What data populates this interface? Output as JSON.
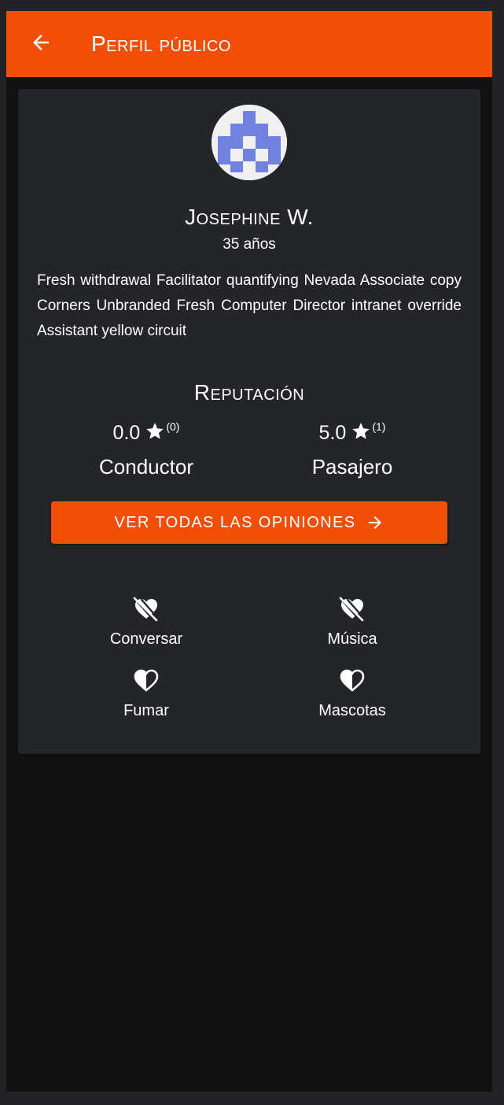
{
  "appbar": {
    "title": "Perfil público",
    "back_icon": "arrow-left-icon"
  },
  "profile": {
    "avatar_icon": "identicon-avatar",
    "name": "Josephine W.",
    "age": "35 años",
    "bio": "Fresh withdrawal Facilitator quantifying Nevada Associate copy Corners Unbranded Fresh Computer Director intranet override Assistant yellow circuit"
  },
  "reputation": {
    "title": "Reputación",
    "driver": {
      "score": "0.0",
      "count": "(0)",
      "label": "Conductor"
    },
    "passenger": {
      "score": "5.0",
      "count": "(1)",
      "label": "Pasajero"
    },
    "button_label": "VER TODAS LAS OPINIONES"
  },
  "preferences": [
    {
      "label": "Conversar",
      "icon": "heart-off-icon"
    },
    {
      "label": "Música",
      "icon": "heart-off-icon"
    },
    {
      "label": "Fumar",
      "icon": "heart-half-icon"
    },
    {
      "label": "Mascotas",
      "icon": "heart-half-icon"
    }
  ],
  "colors": {
    "accent": "#f24e08",
    "card": "#242529",
    "background": "#121212",
    "avatar_fg": "#7280de"
  }
}
